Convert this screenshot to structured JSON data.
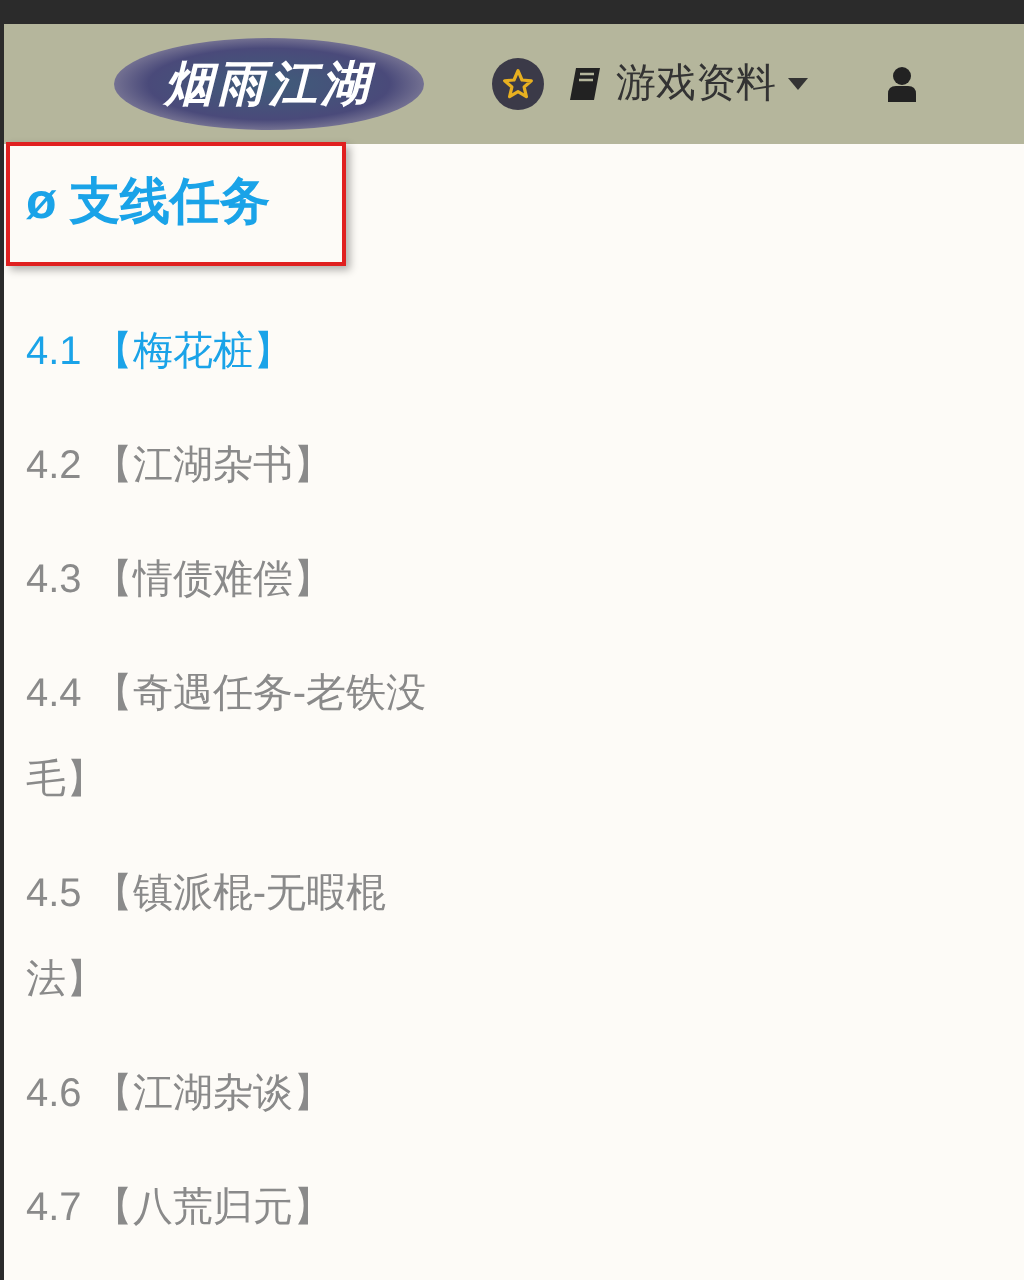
{
  "navbar": {
    "logo": "烟雨江湖",
    "menu": [
      {
        "kind": "star"
      },
      {
        "kind": "dropdown",
        "label": "游戏资料"
      },
      {
        "kind": "user"
      }
    ]
  },
  "section": {
    "title": "ø 支线任务"
  },
  "items": [
    {
      "label": "4.1 【梅花桩】",
      "selected": true
    },
    {
      "label": "4.2 【江湖杂书】",
      "selected": false
    },
    {
      "label": "4.3 【情债难偿】",
      "selected": false
    },
    {
      "label": "4.4 【奇遇任务-老铁没毛】",
      "selected": false
    },
    {
      "label": "4.5 【镇派棍-无暇棍法】",
      "selected": false
    },
    {
      "label": "4.6 【江湖杂谈】",
      "selected": false
    },
    {
      "label": "4.7 【八荒归元】",
      "selected": false
    }
  ]
}
